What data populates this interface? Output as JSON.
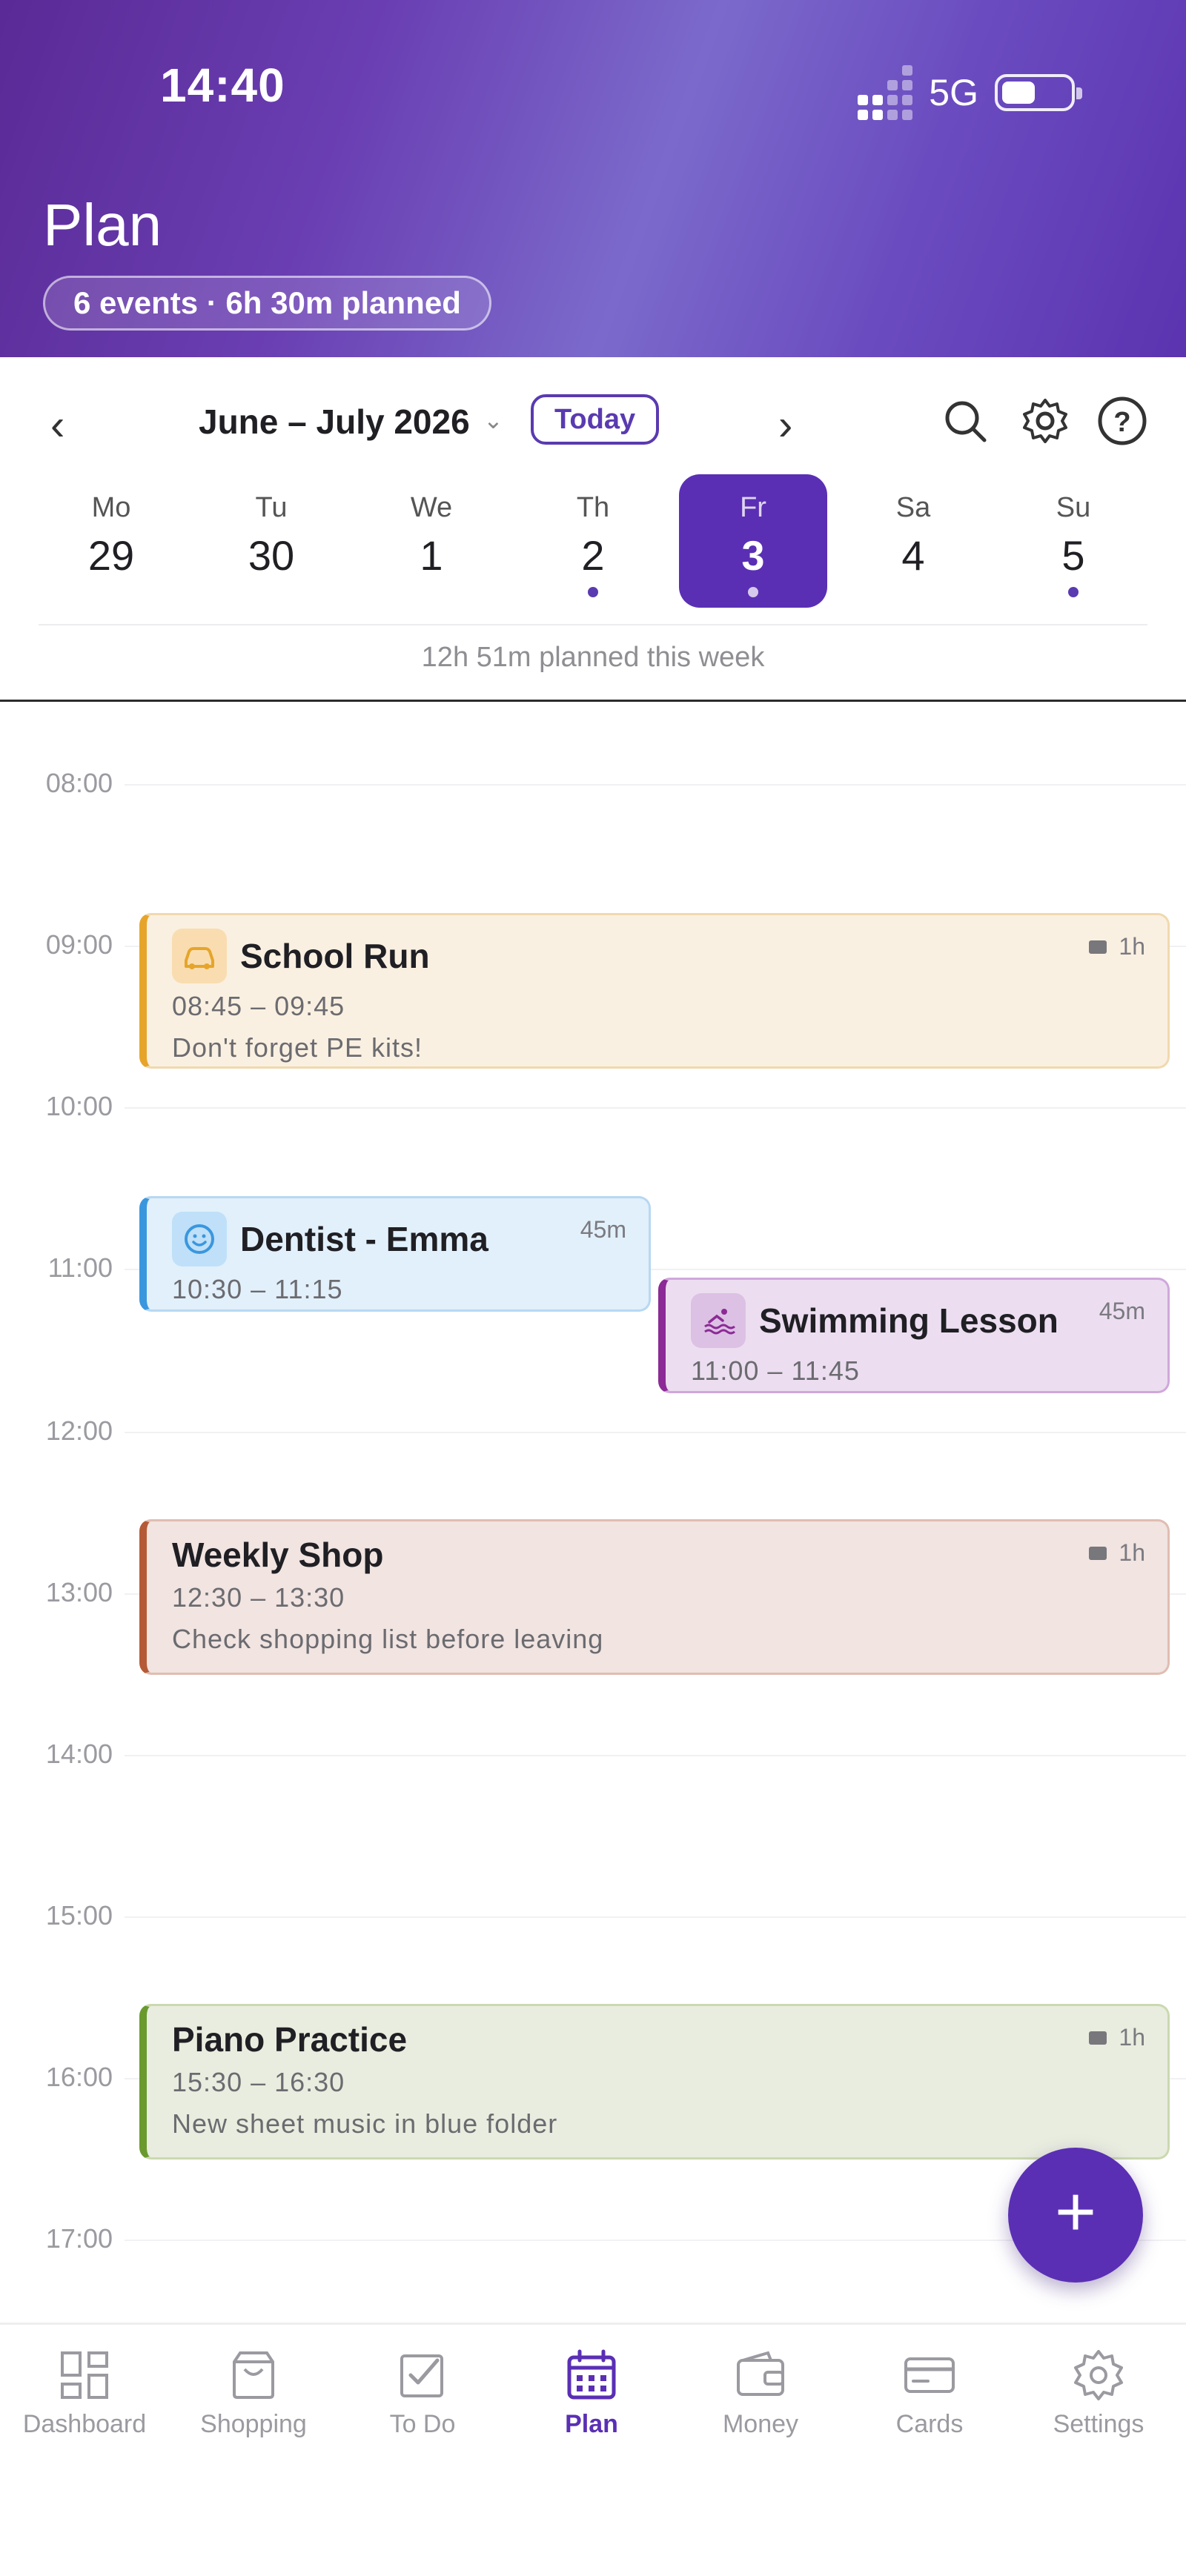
{
  "status_bar": {
    "time": "14:40",
    "network": "5G"
  },
  "header": {
    "title": "Plan",
    "summary": "6 events · 6h 30m planned"
  },
  "week_nav": {
    "month_label": "June – July 2026",
    "today_label": "Today",
    "prev_glyph": "‹",
    "next_glyph": "›",
    "icons": [
      "search-icon",
      "gear-icon",
      "help-icon"
    ]
  },
  "days": [
    {
      "dow": "Mo",
      "num": "29",
      "has_events": false,
      "selected": false
    },
    {
      "dow": "Tu",
      "num": "30",
      "has_events": false,
      "selected": false
    },
    {
      "dow": "We",
      "num": "1",
      "has_events": false,
      "selected": false
    },
    {
      "dow": "Th",
      "num": "2",
      "has_events": true,
      "selected": false
    },
    {
      "dow": "Fr",
      "num": "3",
      "has_events": true,
      "selected": true
    },
    {
      "dow": "Sa",
      "num": "4",
      "has_events": false,
      "selected": false
    },
    {
      "dow": "Su",
      "num": "5",
      "has_events": true,
      "selected": false
    }
  ],
  "week_total": "12h 51m planned this week",
  "hours": [
    "08:00",
    "09:00",
    "10:00",
    "11:00",
    "12:00",
    "13:00",
    "14:00",
    "15:00",
    "16:00",
    "17:00"
  ],
  "events": {
    "school_run": {
      "title": "School Run",
      "time": "08:45 – 09:45",
      "note": "Don't forget PE kits!",
      "duration": "1h",
      "icon": "car-icon",
      "color": "#e6a52a"
    },
    "dentist": {
      "title": "Dentist - Emma",
      "time": "10:30 – 11:15",
      "duration": "45m",
      "icon": "smiley-icon",
      "color": "#3a97de"
    },
    "swimming": {
      "title": "Swimming Lesson",
      "time": "11:00 – 11:45",
      "duration": "45m",
      "icon": "swimmer-icon",
      "color": "#8c2a96"
    },
    "weekly_shop": {
      "title": "Weekly Shop",
      "time": "12:30 – 13:30",
      "note": "Check shopping list before leaving",
      "duration": "1h",
      "color": "#b55a36"
    },
    "piano": {
      "title": "Piano Practice",
      "time": "15:30 – 16:30",
      "note": "New sheet music in blue folder",
      "duration": "1h",
      "color": "#6a9a2e"
    }
  },
  "fab": {
    "label": "+"
  },
  "tabs": [
    {
      "label": "Dashboard",
      "icon": "dashboard-icon",
      "active": false
    },
    {
      "label": "Shopping",
      "icon": "shopping-bag-icon",
      "active": false
    },
    {
      "label": "To Do",
      "icon": "checkbox-icon",
      "active": false
    },
    {
      "label": "Plan",
      "icon": "calendar-icon",
      "active": true
    },
    {
      "label": "Money",
      "icon": "wallet-icon",
      "active": false
    },
    {
      "label": "Cards",
      "icon": "card-icon",
      "active": false
    },
    {
      "label": "Settings",
      "icon": "gear-icon",
      "active": false
    }
  ],
  "colors": {
    "accent": "#5a2fb4",
    "header_start": "#5a2a96",
    "header_mid": "#7b6acb"
  }
}
